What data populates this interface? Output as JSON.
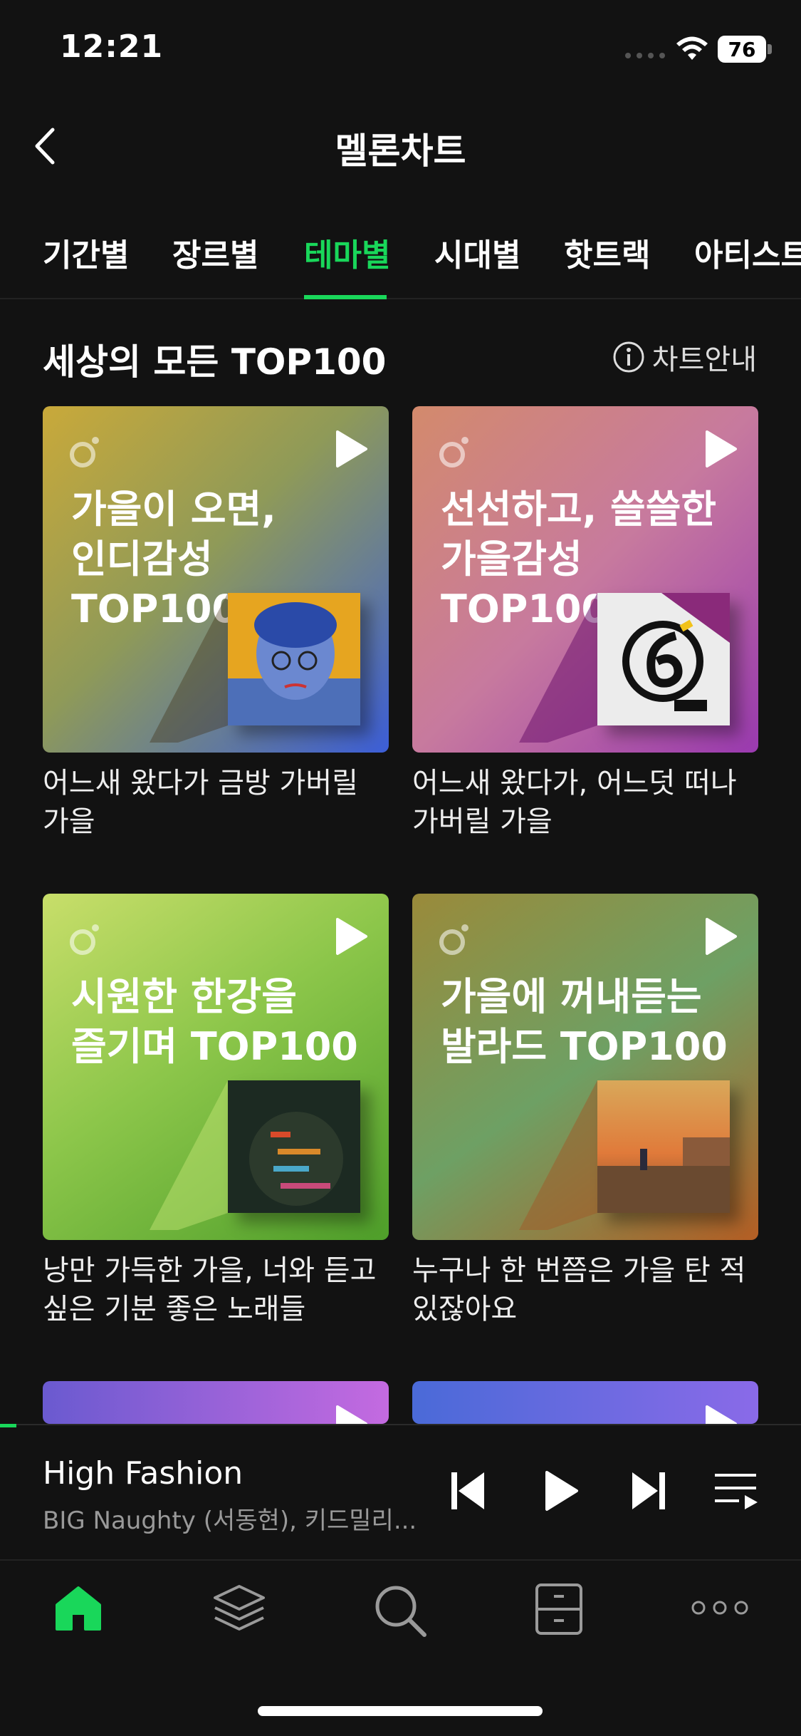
{
  "status_bar": {
    "time": "12:21",
    "battery": "76"
  },
  "header": {
    "title": "멜론차트"
  },
  "tabs": [
    {
      "label": "기간별"
    },
    {
      "label": "장르별"
    },
    {
      "label": "테마별"
    },
    {
      "label": "시대별"
    },
    {
      "label": "핫트랙"
    },
    {
      "label": "아티스트"
    }
  ],
  "section": {
    "title": "세상의 모든 TOP100",
    "guide_label": "차트안내"
  },
  "cards": [
    {
      "headline": "가을이 오면,\n인디감성 TOP100",
      "description": "어느새 왔다가 금방 가버릴 가을"
    },
    {
      "headline": "선선하고, 쓸쓸한\n가을감성 TOP100",
      "description": "어느새 왔다가, 어느덧 떠나 가버릴 가을"
    },
    {
      "headline": "시원한 한강을\n즐기며 TOP100",
      "description": "낭만 가득한 가을, 너와 듣고 싶은 기분 좋은 노래들"
    },
    {
      "headline": "가을에 꺼내듣는\n발라드 TOP100",
      "description": "누구나 한 번쯤은 가을 탄 적 있잖아요"
    }
  ],
  "player": {
    "song": "High Fashion",
    "artist": "BIG Naughty (서동현), 키드밀리...",
    "progress": 0.02
  },
  "nav": [
    "home-icon",
    "layers-icon",
    "search-icon",
    "library-icon",
    "more-icon"
  ],
  "colors": {
    "accent": "#19d75a",
    "background": "#121212"
  }
}
